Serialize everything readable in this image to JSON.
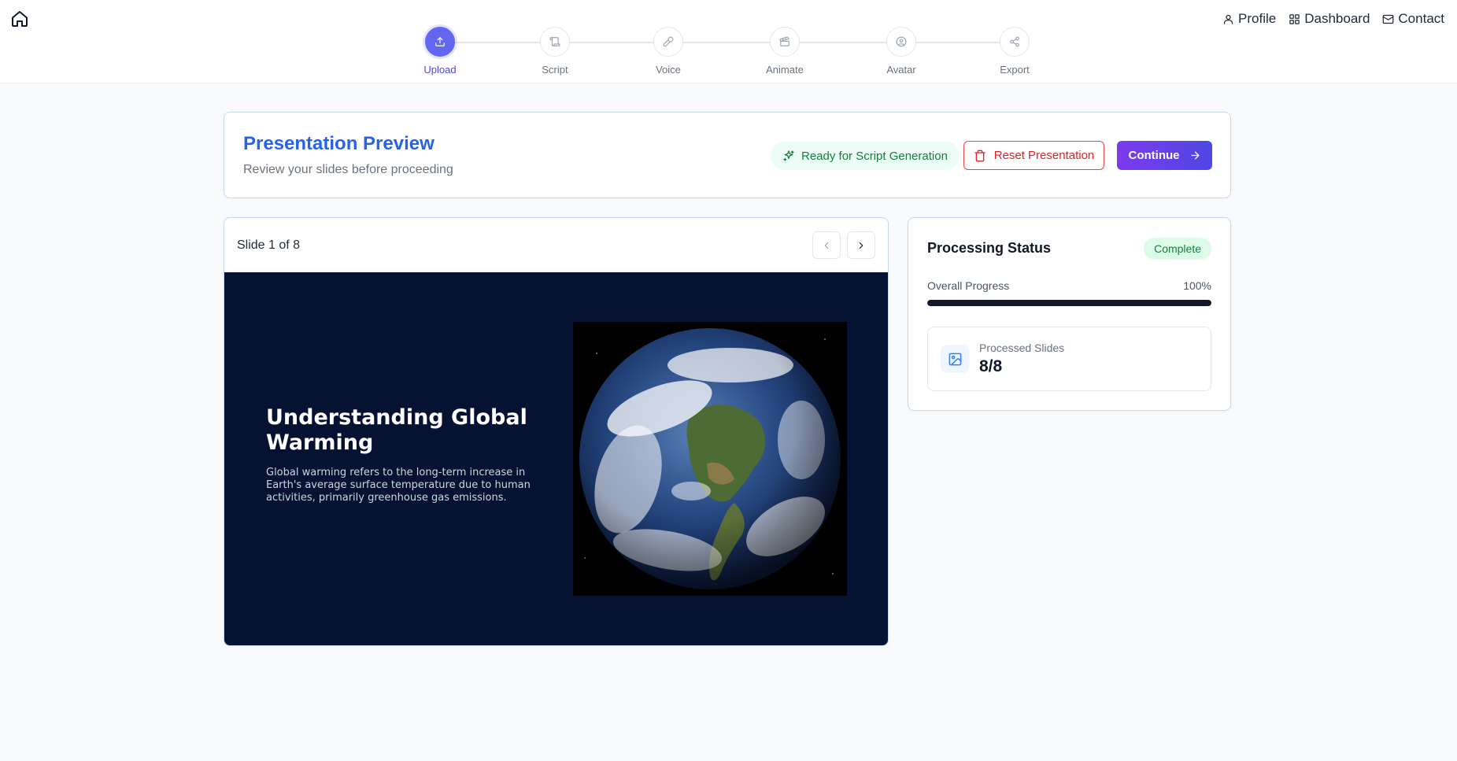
{
  "nav": {
    "profile": "Profile",
    "dashboard": "Dashboard",
    "contact": "Contact"
  },
  "steps": [
    {
      "label": "Upload",
      "icon": "upload-icon",
      "active": true
    },
    {
      "label": "Script",
      "icon": "script-icon",
      "active": false
    },
    {
      "label": "Voice",
      "icon": "microphone-icon",
      "active": false
    },
    {
      "label": "Animate",
      "icon": "clapperboard-icon",
      "active": false
    },
    {
      "label": "Avatar",
      "icon": "user-circle-icon",
      "active": false
    },
    {
      "label": "Export",
      "icon": "share-icon",
      "active": false
    }
  ],
  "header": {
    "title": "Presentation Preview",
    "subtitle": "Review your slides before proceeding",
    "ready_label": "Ready for Script Generation",
    "reset_label": "Reset Presentation",
    "continue_label": "Continue"
  },
  "viewer": {
    "counter": "Slide 1 of 8",
    "slide": {
      "title": "Understanding Global Warming",
      "body": "Global warming refers to the long-term increase in Earth's average surface temperature due to human activities, primarily greenhouse gas emissions.",
      "image": "earth-globe-image"
    }
  },
  "status": {
    "title": "Processing Status",
    "badge": "Complete",
    "progress_label": "Overall Progress",
    "progress_value": "100%",
    "progress_fraction": 1.0,
    "slides_label": "Processed Slides",
    "slides_value": "8/8"
  },
  "colors": {
    "accent": "#6366f1",
    "title_blue": "#2563eb",
    "success": "#15803d",
    "danger": "#dc2626",
    "slide_bg": "#051232"
  }
}
